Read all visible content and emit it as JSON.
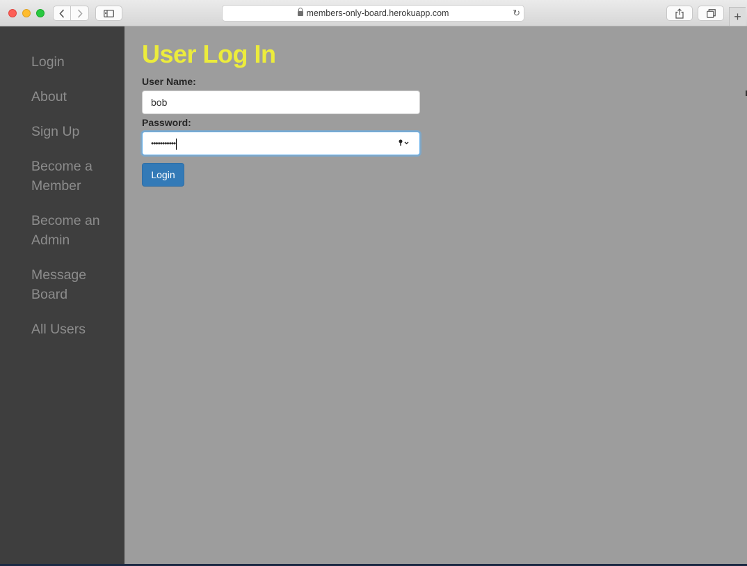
{
  "browser": {
    "url": "members-only-board.herokuapp.com",
    "new_tab_label": "+"
  },
  "sidebar": {
    "items": [
      {
        "label": "Login"
      },
      {
        "label": "About"
      },
      {
        "label": "Sign Up"
      },
      {
        "label": "Become a Member"
      },
      {
        "label": "Become an Admin"
      },
      {
        "label": "Message Board"
      },
      {
        "label": "All Users"
      }
    ]
  },
  "form": {
    "title": "User Log In",
    "username_label": "User Name:",
    "username_value": "bob",
    "password_label": "Password:",
    "password_value": "•••••••••••",
    "submit_label": "Login"
  },
  "colors": {
    "title": "#ecec3c",
    "sidebar_bg": "#3e3e3e",
    "page_bg": "#9d9d9d",
    "button": "#337ab7"
  }
}
